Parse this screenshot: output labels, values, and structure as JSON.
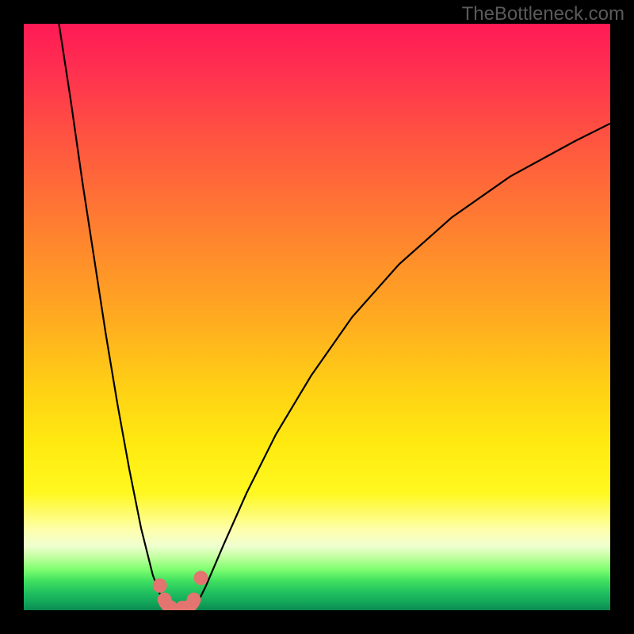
{
  "watermark": "TheBottleneck.com",
  "chart_data": {
    "type": "line",
    "title": "",
    "xlabel": "",
    "ylabel": "",
    "xlim": [
      0,
      100
    ],
    "ylim": [
      0,
      100
    ],
    "series": [
      {
        "name": "left-curve",
        "x": [
          6,
          8,
          10,
          12,
          14,
          16,
          18,
          20,
          22,
          23.5,
          25
        ],
        "y": [
          100,
          87,
          73,
          60,
          47,
          35,
          24,
          14,
          6,
          2,
          0
        ]
      },
      {
        "name": "right-curve",
        "x": [
          29,
          31,
          34,
          38,
          43,
          49,
          56,
          64,
          73,
          83,
          94,
          100
        ],
        "y": [
          0,
          4,
          11,
          20,
          30,
          40,
          50,
          59,
          67,
          74,
          80,
          83
        ]
      },
      {
        "name": "valley-floor",
        "x": [
          24,
          25,
          26,
          27,
          28,
          29
        ],
        "y": [
          1.2,
          0,
          0,
          0,
          0,
          1.2
        ]
      }
    ],
    "markers": {
      "name": "valley-dots",
      "color": "#e3746f",
      "points": [
        {
          "x": 23.2,
          "y": 4.2
        },
        {
          "x": 24.0,
          "y": 1.8
        },
        {
          "x": 25.0,
          "y": 0.5
        },
        {
          "x": 27.0,
          "y": 0.4
        },
        {
          "x": 28.0,
          "y": 0.5
        },
        {
          "x": 29.0,
          "y": 1.8
        },
        {
          "x": 30.2,
          "y": 5.5
        }
      ]
    },
    "gradient_stops": [
      {
        "pos": 0,
        "color": "#ff1a55"
      },
      {
        "pos": 0.5,
        "color": "#ffaa20"
      },
      {
        "pos": 0.8,
        "color": "#fff820"
      },
      {
        "pos": 0.91,
        "color": "#c0ffa0"
      },
      {
        "pos": 1.0,
        "color": "#0c8850"
      }
    ]
  }
}
